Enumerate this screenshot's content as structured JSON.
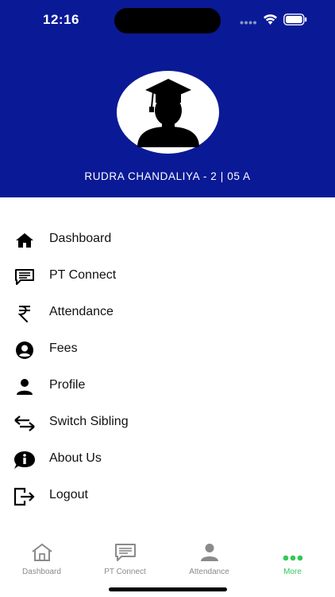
{
  "status_bar": {
    "time": "12:16"
  },
  "profile": {
    "name": "RUDRA CHANDALIYA - 2 | 05 A"
  },
  "menu": {
    "items": [
      {
        "label": "Dashboard",
        "icon": "home-icon"
      },
      {
        "label": "PT Connect",
        "icon": "chat-icon"
      },
      {
        "label": "Attendance",
        "icon": "rupee-icon"
      },
      {
        "label": "Fees",
        "icon": "account-circle-icon"
      },
      {
        "label": "Profile",
        "icon": "person-icon"
      },
      {
        "label": "Switch Sibling",
        "icon": "swap-arrows-icon"
      },
      {
        "label": "About Us",
        "icon": "info-icon"
      },
      {
        "label": "Logout",
        "icon": "logout-icon"
      }
    ]
  },
  "tabbar": {
    "tabs": [
      {
        "label": "Dashboard",
        "icon": "home-icon",
        "active": false
      },
      {
        "label": "PT Connect",
        "icon": "chat-icon",
        "active": false
      },
      {
        "label": "Attendance",
        "icon": "person-icon",
        "active": false
      },
      {
        "label": "More",
        "icon": "more-dots-icon",
        "active": true
      }
    ]
  },
  "colors": {
    "header_bg": "#0a1a96",
    "active_tab": "#34c759",
    "inactive_tab": "#8a8a8a"
  }
}
